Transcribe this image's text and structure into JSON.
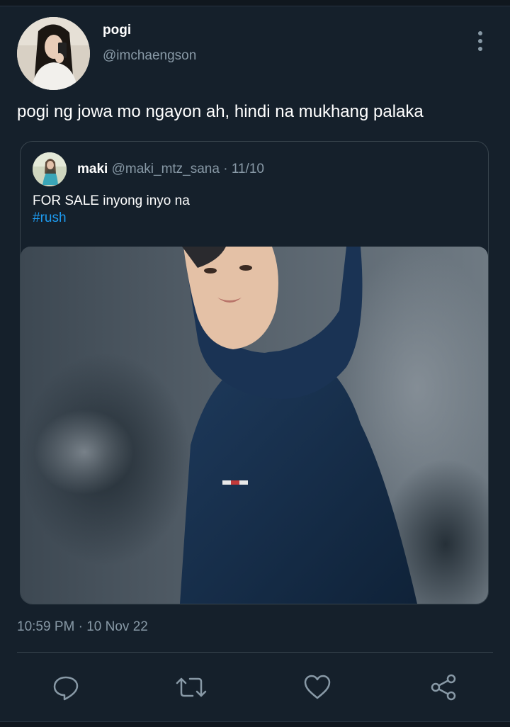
{
  "tweet": {
    "author_name": "pogi",
    "author_handle": "@imchaengson",
    "text": "pogi ng jowa mo ngayon ah, hindi na mukhang palaka",
    "timestamp": "10:59 PM · 10 Nov 22"
  },
  "quote": {
    "name": "maki",
    "handle": "@maki_mtz_sana",
    "separator": "·",
    "date": "11/10",
    "text": "FOR SALE inyong inyo na",
    "hashtag": "#rush"
  },
  "actions": {
    "reply_icon": "reply-icon",
    "retweet_icon": "retweet-icon",
    "like_icon": "heart-icon",
    "share_icon": "share-icon"
  },
  "colors": {
    "background": "#15202b",
    "secondary_text": "#8899a6",
    "link": "#1d9bf0",
    "border": "#38444d"
  }
}
